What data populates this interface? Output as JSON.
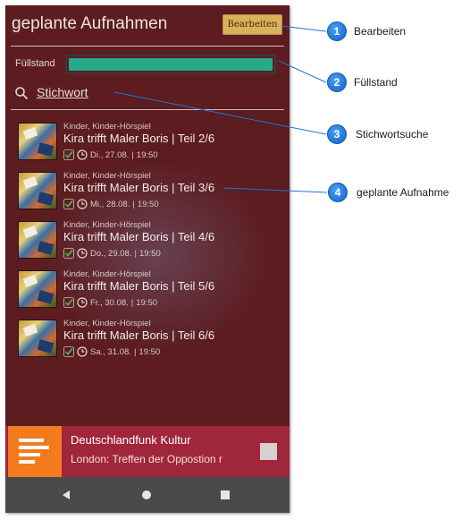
{
  "header": {
    "title": "geplante Aufnahmen",
    "edit_label": "Bearbeiten"
  },
  "fill": {
    "label": "Füllstand",
    "level_fraction": 1.0
  },
  "search": {
    "text": "Stichwort"
  },
  "recordings": [
    {
      "category": "Kinder, Kinder-Hörspiel",
      "title": "Kira trifft Maler Boris | Teil 2/6",
      "date": "Di., 27.08.",
      "time": "19:50"
    },
    {
      "category": "Kinder, Kinder-Hörspiel",
      "title": "Kira trifft Maler Boris | Teil 3/6",
      "date": "Mi., 28.08.",
      "time": "19:50"
    },
    {
      "category": "Kinder, Kinder-Hörspiel",
      "title": "Kira trifft Maler Boris | Teil 4/6",
      "date": "Do., 29.08.",
      "time": "19:50"
    },
    {
      "category": "Kinder, Kinder-Hörspiel",
      "title": "Kira trifft Maler Boris | Teil 5/6",
      "date": "Fr., 30.08.",
      "time": "19:50"
    },
    {
      "category": "Kinder, Kinder-Hörspiel",
      "title": "Kira trifft Maler Boris | Teil 6/6",
      "date": "Sa., 31.08.",
      "time": "19:50"
    }
  ],
  "meta_separator": "|",
  "player": {
    "station": "Deutschlandfunk Kultur",
    "now_playing": "London: Treffen der Oppostion r"
  },
  "callouts": [
    {
      "number": "1",
      "label": "Bearbeiten"
    },
    {
      "number": "2",
      "label": "Füllstand"
    },
    {
      "number": "3",
      "label": "Stichwortsuche"
    },
    {
      "number": "4",
      "label": "geplante Aufnahme"
    }
  ],
  "colors": {
    "background": "#5c1c20",
    "accent_button": "#d9b15a",
    "fill_bar": "#27a98a",
    "player_bar": "#a0263a",
    "player_logo": "#f47a1e",
    "callout": "#1f74d6",
    "check": "#4caf50"
  },
  "icons": {
    "search": "search-icon",
    "check": "check-icon",
    "clock": "clock-icon",
    "back": "back-triangle-icon",
    "home": "home-circle-icon",
    "recents": "recents-square-icon",
    "stop": "stop-icon",
    "logo": "station-logo-icon"
  }
}
